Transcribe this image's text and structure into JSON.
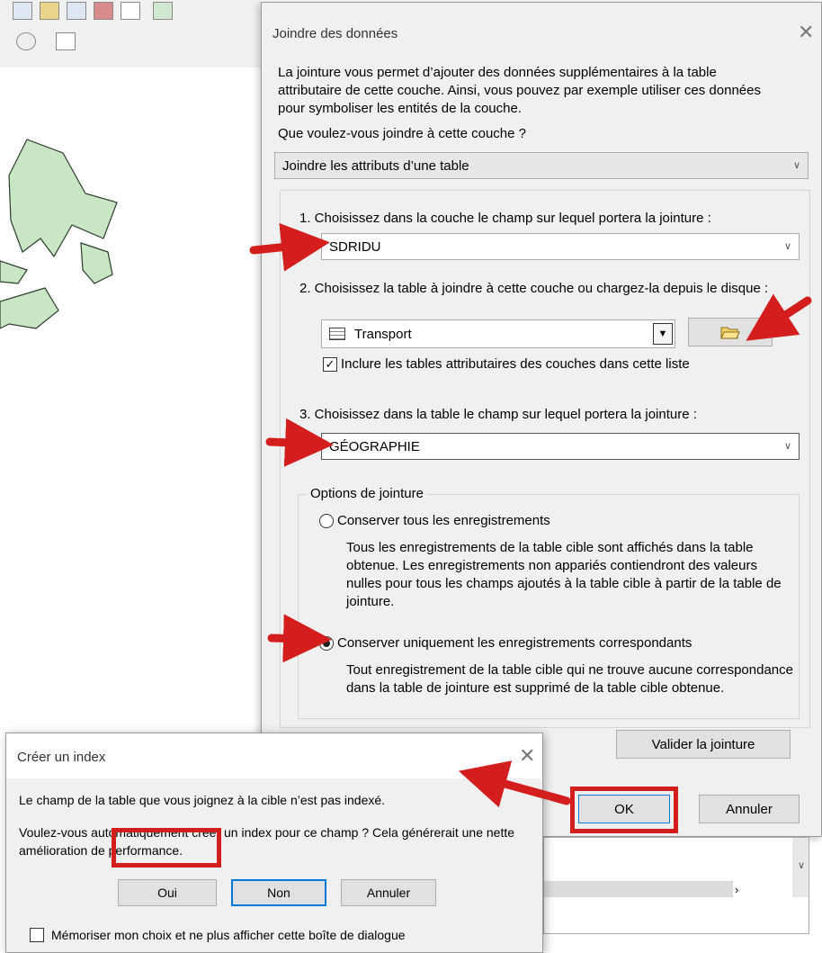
{
  "join_dialog": {
    "title": "Joindre des données",
    "intro": "La jointure vous permet d’ajouter des données supplémentaires à la table attributaire de cette couche. Ainsi, vous pouvez par exemple utiliser ces données pour symboliser les entités de la couche.",
    "question": "Que voulez-vous joindre à cette couche ?",
    "join_type": "Joindre les attributs d’une table",
    "step1_label": "1. Choisissez dans la couche le champ sur lequel portera la jointure :",
    "step1_value": "SDRIDU",
    "step2_label": "2. Choisissez la table à joindre à cette couche ou chargez-la depuis le disque :",
    "step2_value": "Transport",
    "include_label": "Inclure les tables attributaires des couches dans cette liste",
    "include_checked": true,
    "step3_label": "3. Choisissez dans la table le champ sur lequel portera la jointure :",
    "step3_value": "GÉOGRAPHIE",
    "options_title": "Options de jointure",
    "option_all_label": "Conserver tous les enregistrements",
    "option_all_desc": "Tous les enregistrements de la table cible sont affichés dans la table obtenue. Les enregistrements non appariés contiendront des valeurs nulles pour tous les champs ajoutés à la table cible à partir de la table de jointure.",
    "option_match_label": "Conserver uniquement les enregistrements correspondants",
    "option_match_desc": "Tout enregistrement de la table cible qui ne trouve aucune correspondance dans la table de jointure est supprimé de la table cible obtenue.",
    "selected_option": "match",
    "validate_button": "Valider la jointure",
    "ok_button": "OK",
    "cancel_button": "Annuler"
  },
  "index_dialog": {
    "title": "Créer un index",
    "message1": "Le champ de la table que vous joignez à la cible n’est pas indexé.",
    "message2": "Voulez-vous automatiquement créer un index pour ce champ ? Cela générerait une nette amélioration de performance.",
    "yes_button": "Oui",
    "no_button": "Non",
    "cancel_button": "Annuler",
    "remember_label": "Mémoriser mon choix et ne plus afficher cette boîte de dialogue",
    "remember_checked": false
  },
  "colors": {
    "annotation_red": "#d41d1d",
    "map_fill": "#c8e6c4",
    "focus_blue": "#0078d7"
  },
  "icons": [
    "table-icon",
    "open-folder-icon",
    "close-icon",
    "chevron-down-icon",
    "red-arrow-icon"
  ]
}
